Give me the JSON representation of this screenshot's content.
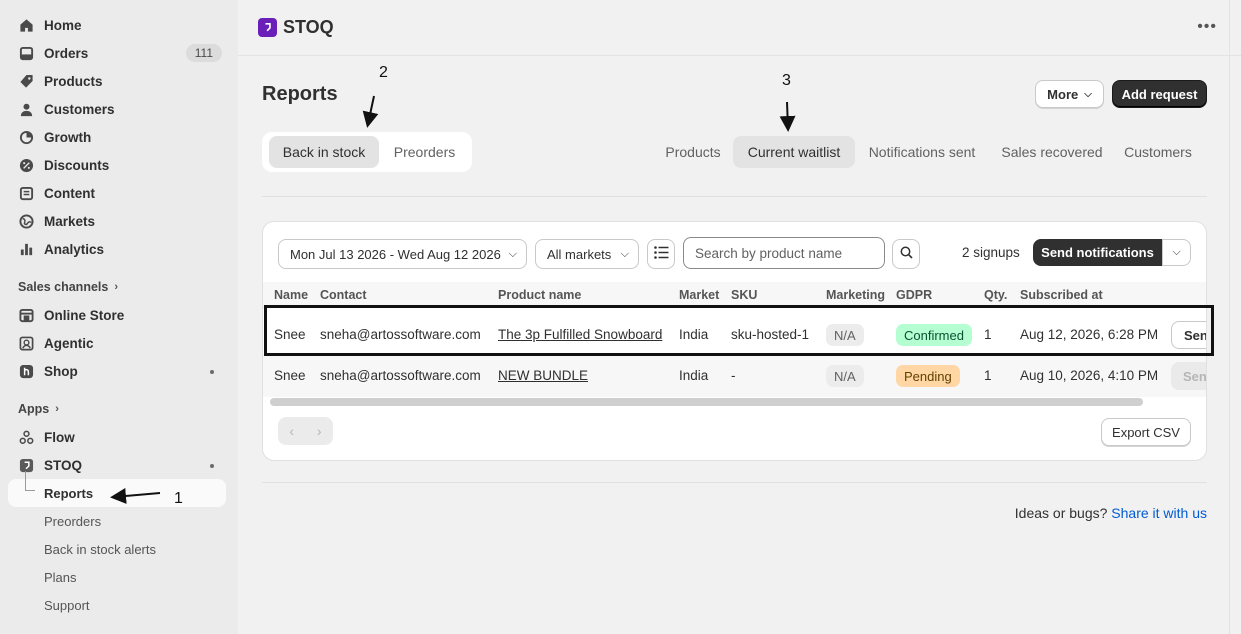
{
  "sidebar": {
    "items": [
      {
        "label": "Home",
        "icon": "home-icon"
      },
      {
        "label": "Orders",
        "icon": "orders-icon",
        "badge": "111"
      },
      {
        "label": "Products",
        "icon": "tag-icon"
      },
      {
        "label": "Customers",
        "icon": "person-icon"
      },
      {
        "label": "Growth",
        "icon": "growth-icon"
      },
      {
        "label": "Discounts",
        "icon": "discount-icon"
      },
      {
        "label": "Content",
        "icon": "content-icon"
      },
      {
        "label": "Markets",
        "icon": "globe-icon"
      },
      {
        "label": "Analytics",
        "icon": "bar-chart-icon"
      }
    ],
    "sales_channels": {
      "heading": "Sales channels",
      "items": [
        {
          "label": "Online Store",
          "icon": "store-icon"
        },
        {
          "label": "Agentic",
          "icon": "agentic-icon"
        },
        {
          "label": "Shop",
          "icon": "shop-icon"
        }
      ]
    },
    "apps": {
      "heading": "Apps",
      "items": [
        {
          "label": "Flow",
          "icon": "flow-icon"
        },
        {
          "label": "STOQ",
          "icon": "stoq-icon"
        }
      ],
      "sub_items": [
        "Reports",
        "Preorders",
        "Back in stock alerts",
        "Plans",
        "Support"
      ]
    }
  },
  "topbar": {
    "app_title": "STOQ"
  },
  "page": {
    "title": "Reports",
    "more_label": "More",
    "add_request_label": "Add request",
    "segments": [
      "Back in stock",
      "Preorders"
    ],
    "tabs": [
      "Products",
      "Current waitlist",
      "Notifications sent",
      "Sales recovered",
      "Customers"
    ]
  },
  "filters": {
    "date_range": "Mon Jul 13 2026 - Wed Aug 12 2026",
    "market": "All markets",
    "search_placeholder": "Search by product name",
    "signups": "2 signups",
    "send_label": "Send notifications"
  },
  "table": {
    "headers": [
      "Name",
      "Contact",
      "Product name",
      "Market",
      "SKU",
      "Marketing",
      "GDPR",
      "Qty.",
      "Subscribed at"
    ],
    "rows": [
      {
        "name": "Snee",
        "contact": "sneha@artossoftware.com",
        "product": "The 3p Fulfilled Snowboard",
        "market": "India",
        "sku": "sku-hosted-1",
        "marketing": "N/A",
        "gdpr": "Confirmed",
        "qty": "1",
        "subscribed": "Aug 12, 2026, 6:28 PM",
        "action": "Send"
      },
      {
        "name": "Snee",
        "contact": "sneha@artossoftware.com",
        "product": "NEW BUNDLE",
        "market": "India",
        "sku": "-",
        "marketing": "N/A",
        "gdpr": "Pending",
        "qty": "1",
        "subscribed": "Aug 10, 2026, 4:10 PM",
        "action": "Send"
      }
    ],
    "export_label": "Export CSV"
  },
  "footer": {
    "text": "Ideas or bugs?",
    "link": "Share it with us"
  },
  "annotations": [
    "1",
    "2",
    "3"
  ],
  "colors": {
    "brand": "#6a1fb8",
    "confirmed_bg": "#b4fed2",
    "pending_bg": "#ffd6a4",
    "link": "#005bd3"
  }
}
